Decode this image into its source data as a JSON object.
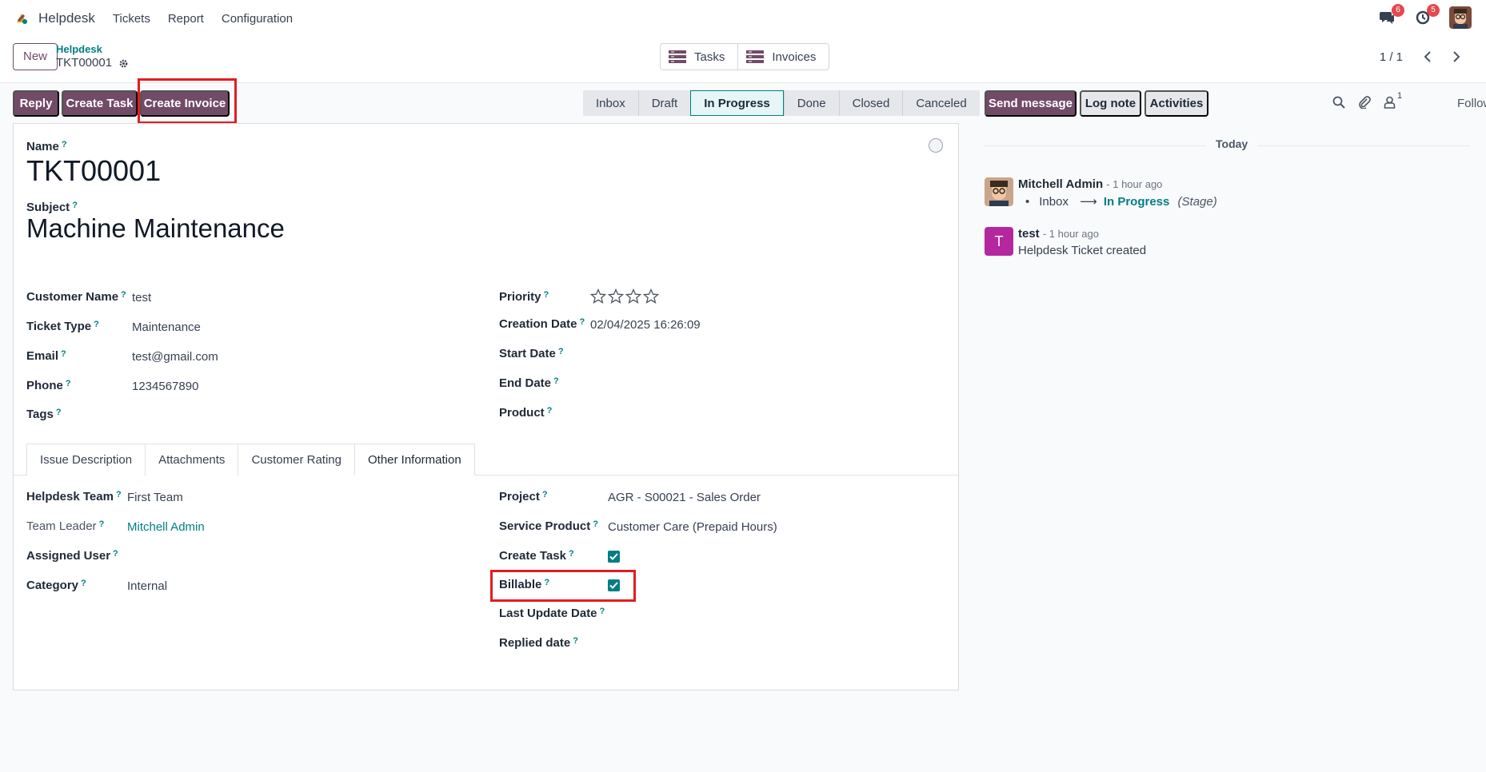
{
  "navbar": {
    "app_name": "Helpdesk",
    "menu": [
      "Tickets",
      "Report",
      "Configuration"
    ],
    "messages_count": "6",
    "activities_count": "5"
  },
  "control": {
    "new_label": "New",
    "breadcrumb_parent": "Helpdesk",
    "breadcrumb_current": "TKT00001",
    "smart_buttons": [
      "Tasks",
      "Invoices"
    ],
    "pager_value": "1 / 1"
  },
  "actions": {
    "reply": "Reply",
    "create_task": "Create Task",
    "create_invoice": "Create Invoice"
  },
  "stages": [
    "Inbox",
    "Draft",
    "In Progress",
    "Done",
    "Closed",
    "Canceled"
  ],
  "active_stage": "In Progress",
  "form": {
    "name_label": "Name",
    "name_value": "TKT00001",
    "subject_label": "Subject",
    "subject_value": "Machine Maintenance",
    "customer_name_label": "Customer Name",
    "customer_name_value": "test",
    "ticket_type_label": "Ticket Type",
    "ticket_type_value": "Maintenance",
    "email_label": "Email",
    "email_value": "test@gmail.com",
    "phone_label": "Phone",
    "phone_value": "1234567890",
    "tags_label": "Tags",
    "priority_label": "Priority",
    "priority_stars_filled": 0,
    "priority_stars_total": 4,
    "creation_date_label": "Creation Date",
    "creation_date_value": "02/04/2025 16:26:09",
    "start_date_label": "Start Date",
    "end_date_label": "End Date",
    "product_label": "Product"
  },
  "tabs": [
    "Issue Description",
    "Attachments",
    "Customer Rating",
    "Other Information"
  ],
  "active_tab": "Other Information",
  "other_info": {
    "helpdesk_team_label": "Helpdesk Team",
    "helpdesk_team_value": "First Team",
    "team_leader_label": "Team Leader",
    "team_leader_value": "Mitchell Admin",
    "assigned_user_label": "Assigned User",
    "category_label": "Category",
    "category_value": "Internal",
    "project_label": "Project",
    "project_value": "AGR - S00021 - Sales Order",
    "service_product_label": "Service Product",
    "service_product_value": "Customer Care (Prepaid Hours)",
    "create_task_label": "Create Task",
    "create_task_checked": true,
    "billable_label": "Billable",
    "billable_checked": true,
    "last_update_label": "Last Update Date",
    "replied_date_label": "Replied date"
  },
  "help_mark": "?",
  "chatter": {
    "send_message": "Send message",
    "log_note": "Log note",
    "activities": "Activities",
    "followers_count": "1",
    "follow": "Follow",
    "today": "Today",
    "messages": [
      {
        "author": "Mitchell Admin",
        "time": "- 1 hour ago",
        "from_stage": "Inbox",
        "arrow": "⟶",
        "to_stage": "In Progress",
        "field": "(Stage)"
      },
      {
        "author": "test",
        "avatar_letter": "T",
        "time": "- 1 hour ago",
        "body": "Helpdesk Ticket created"
      }
    ]
  },
  "colors": {
    "primary": "#714b67",
    "accent": "#017e84",
    "highlight": "#e11d21"
  }
}
